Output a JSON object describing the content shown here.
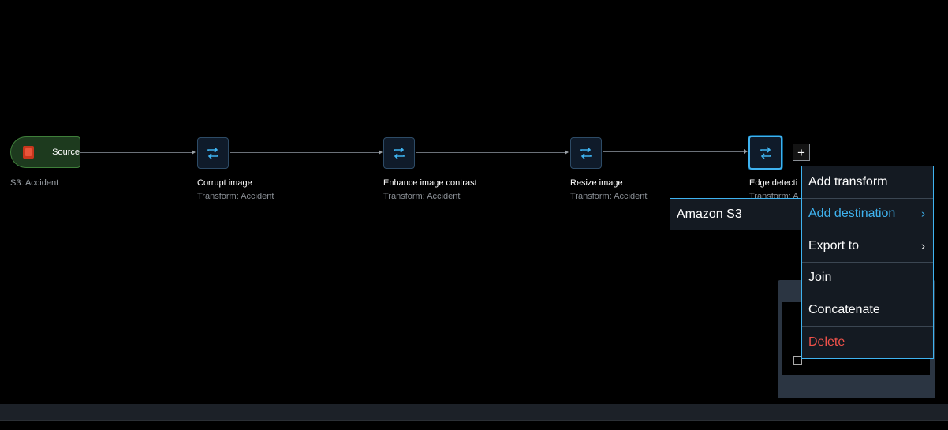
{
  "source": {
    "label": "Source",
    "caption": "S3: Accident",
    "icon": "s3-bucket-icon"
  },
  "nodes": [
    {
      "title": "Corrupt image",
      "sub": "Transform: Accident"
    },
    {
      "title": "Enhance image contrast",
      "sub": "Transform: Accident"
    },
    {
      "title": "Resize image",
      "sub": "Transform: Accident"
    },
    {
      "title": "Edge detecti",
      "sub": "Transform: A"
    }
  ],
  "add_button": {
    "label": "+"
  },
  "submenu": {
    "item": "Amazon S3"
  },
  "menu": {
    "items": [
      {
        "label": "Add transform"
      },
      {
        "label": "Add destination",
        "chevron": "›"
      },
      {
        "label": "Export to",
        "chevron": "›"
      },
      {
        "label": "Join"
      },
      {
        "label": "Concatenate"
      },
      {
        "label": "Delete"
      }
    ]
  },
  "colors": {
    "accent": "#3fb3f0",
    "danger": "#f0524a",
    "source_bg": "#1d3a1e"
  }
}
